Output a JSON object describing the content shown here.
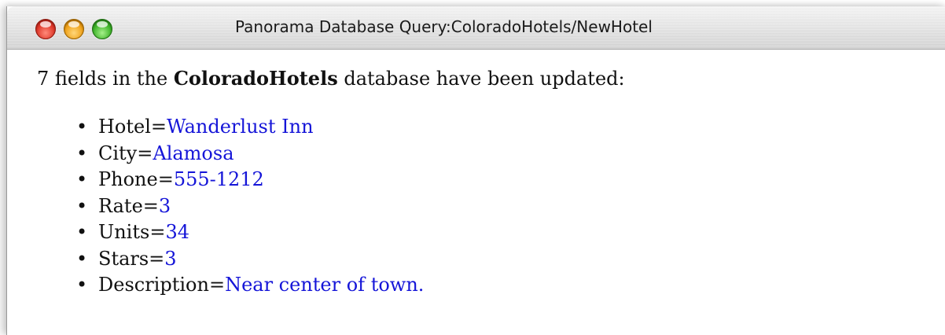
{
  "window": {
    "title": "Panorama Database Query:ColoradoHotels/NewHotel"
  },
  "message": {
    "prefix": "7 fields in the",
    "database": "ColoradoHotels",
    "suffix": "database have been updated:"
  },
  "fields": [
    {
      "name": "Hotel=",
      "value": "Wanderlust Inn"
    },
    {
      "name": "City=",
      "value": "Alamosa"
    },
    {
      "name": "Phone=",
      "value": "555-1212"
    },
    {
      "name": "Rate=",
      "value": "3"
    },
    {
      "name": "Units=",
      "value": "34"
    },
    {
      "name": "Stars=",
      "value": "3"
    },
    {
      "name": "Description=",
      "value": "Near center of town."
    }
  ],
  "colors": {
    "value_text": "#1515d8",
    "close_button": "#e0392b",
    "minimize_button": "#f0a21a",
    "zoom_button": "#3fb52a"
  },
  "icons": {
    "bullet": "•"
  }
}
